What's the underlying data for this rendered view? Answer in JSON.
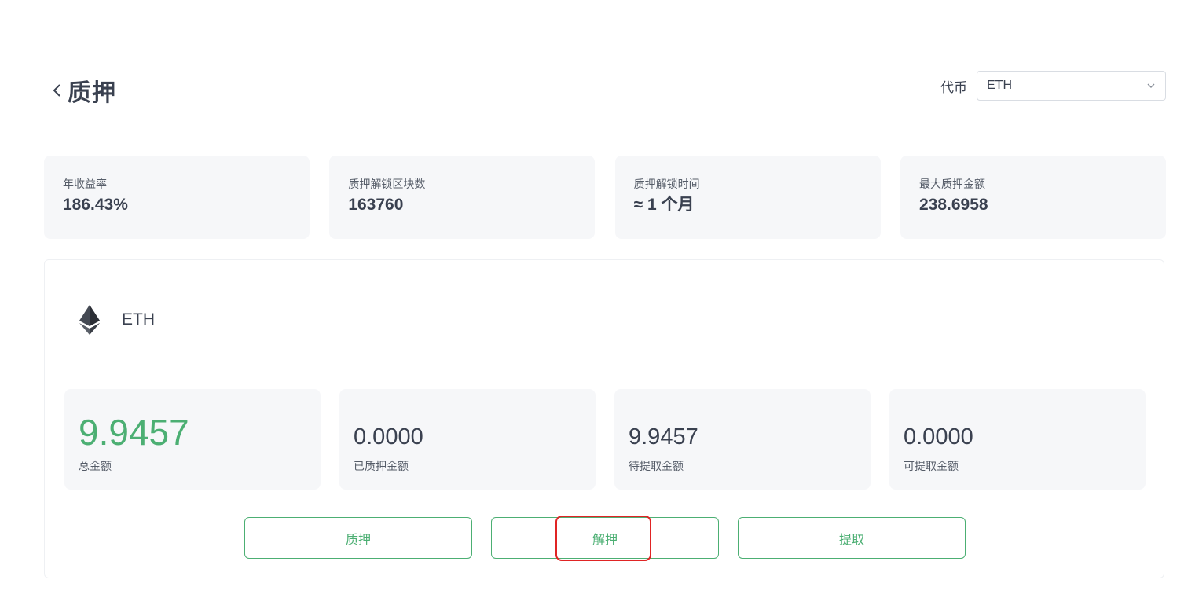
{
  "header": {
    "title": "质押",
    "token_label": "代币",
    "token_selected": "ETH"
  },
  "stats": [
    {
      "label": "年收益率",
      "value": "186.43%"
    },
    {
      "label": "质押解锁区块数",
      "value": "163760"
    },
    {
      "label": "质押解锁时间",
      "value": "≈ 1 个月"
    },
    {
      "label": "最大质押金额",
      "value": "238.6958"
    }
  ],
  "coin": {
    "name": "ETH",
    "icon": "ethereum-icon"
  },
  "amounts": [
    {
      "value": "9.9457",
      "label": "总金额"
    },
    {
      "value": "0.0000",
      "label": "已质押金额"
    },
    {
      "value": "9.9457",
      "label": "待提取金额"
    },
    {
      "value": "0.0000",
      "label": "可提取金额"
    }
  ],
  "actions": {
    "stake_label": "质押",
    "unstake_label": "解押",
    "withdraw_label": "提取"
  },
  "colors": {
    "accent": "#4caf73",
    "highlight": "#e02424",
    "card_bg": "#f6f7f9"
  }
}
